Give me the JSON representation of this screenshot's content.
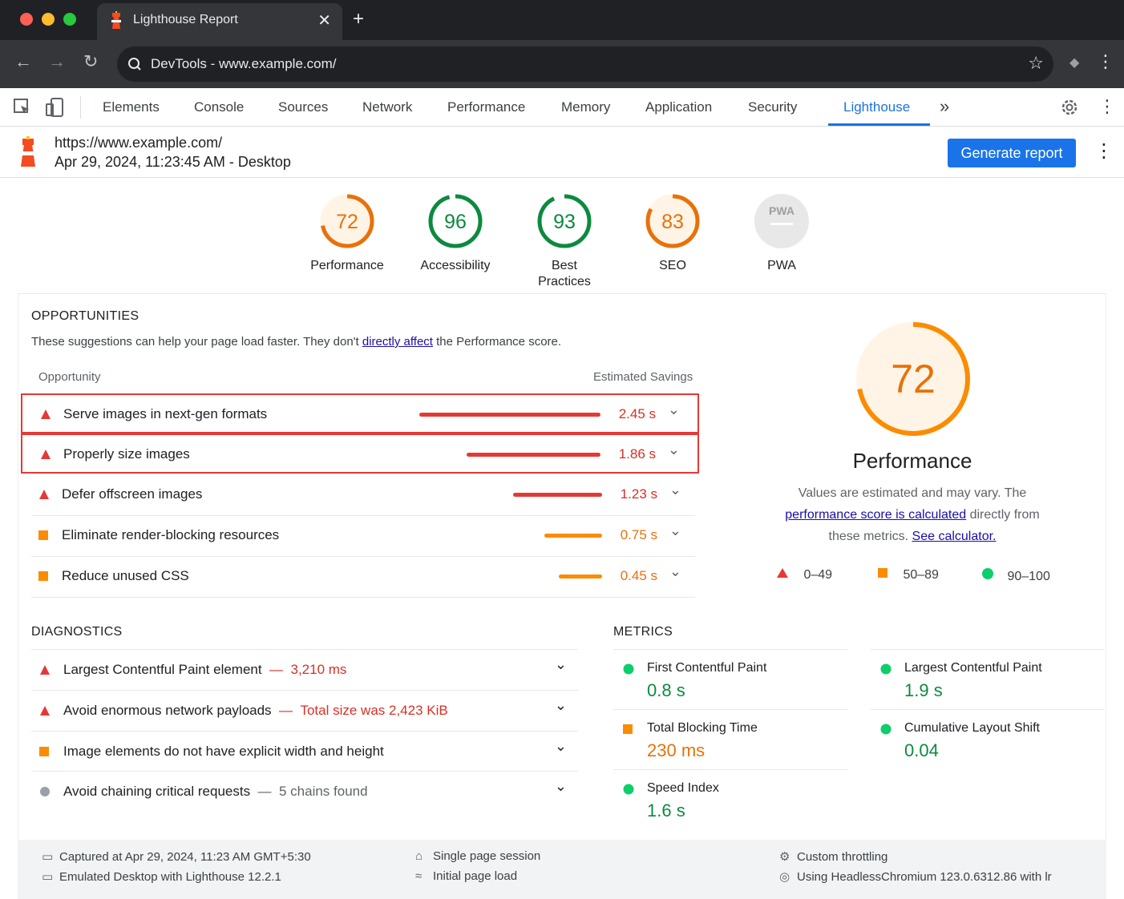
{
  "browser": {
    "tab_title": "Lighthouse Report",
    "tab_close": "✕",
    "new_tab": "+",
    "address": "DevTools - www.example.com/"
  },
  "devtools": {
    "tabs": [
      "Elements",
      "Console",
      "Sources",
      "Network",
      "Performance",
      "Memory",
      "Application",
      "Security",
      "Lighthouse"
    ],
    "more": "»"
  },
  "report": {
    "url": "https://www.example.com/",
    "date": "Apr 29, 2024, 11:23:45 AM - Desktop",
    "generate_label": "Generate report"
  },
  "gauges": [
    {
      "score": "72",
      "label": "Performance",
      "level": 0.72,
      "color": "#e8710a",
      "fill": "#fff4e5"
    },
    {
      "score": "96",
      "label": "Accessibility",
      "level": 0.96,
      "color": "#0c8a3e",
      "fill": "#ffffff"
    },
    {
      "score": "93",
      "label": "Best Practices",
      "level": 0.93,
      "color": "#0c8a3e",
      "fill": "#ffffff"
    },
    {
      "score": "83",
      "label": "SEO",
      "level": 0.83,
      "color": "#e8710a",
      "fill": "#fff4e5"
    },
    {
      "score": "PWA",
      "label": "PWA",
      "level": 0,
      "color": "#9aa0a6",
      "fill": "#e8e8e8"
    }
  ],
  "opportunities": {
    "title": "OPPORTUNITIES",
    "desc_before": "These suggestions can help your page load faster. They don't ",
    "desc_link": "directly affect",
    "desc_after": " the Performance score.",
    "col_opportunity": "Opportunity",
    "col_savings": "Estimated Savings",
    "items": [
      {
        "title": "Serve images in next-gen formats",
        "savings": "2.45 s",
        "severity": "fail",
        "fraction": 1.0
      },
      {
        "title": "Properly size images",
        "savings": "1.86 s",
        "severity": "fail",
        "fraction": 0.74
      },
      {
        "title": "Defer offscreen images",
        "savings": "1.23 s",
        "severity": "fail",
        "fraction": 0.49
      },
      {
        "title": "Eliminate render-blocking resources",
        "savings": "0.75 s",
        "severity": "average",
        "fraction": 0.32
      },
      {
        "title": "Reduce unused CSS",
        "savings": "0.45 s",
        "severity": "average",
        "fraction": 0.24
      }
    ]
  },
  "performance": {
    "score": "72",
    "level": 0.72,
    "title": "Performance",
    "desc_1": "Values are estimated and may vary. The",
    "desc_link": "performance score is calculated",
    "desc_2": " directly from",
    "desc_3": "these metrics. ",
    "desc_link2": "See calculator.",
    "legend": [
      "0–49",
      "50–89",
      "90–100"
    ]
  },
  "diagnostics": {
    "title": "DIAGNOSTICS",
    "items": [
      {
        "title": "Largest Contentful Paint element",
        "detail": " — 3,210 ms",
        "severity": "fail"
      },
      {
        "title": "Avoid enormous network payloads",
        "detail": " — Total size was 2,423 KiB",
        "severity": "fail"
      },
      {
        "title": "Image elements do not have explicit width and height",
        "detail": "",
        "severity": "average"
      },
      {
        "title": "Avoid chaining critical requests",
        "detail": " — 5 chains found",
        "severity": "info"
      }
    ]
  },
  "metrics": {
    "title": "METRICS",
    "items": [
      {
        "name": "First Contentful Paint",
        "value": "0.8 s",
        "severity": "pass"
      },
      {
        "name": "Largest Contentful Paint",
        "value": "1.9 s",
        "severity": "pass"
      },
      {
        "name": "Total Blocking Time",
        "value": "230 ms",
        "severity": "average"
      },
      {
        "name": "Cumulative Layout Shift",
        "value": "0.04",
        "severity": "pass"
      },
      {
        "name": "Speed Index",
        "value": "1.6 s",
        "severity": "pass"
      }
    ]
  },
  "footer": {
    "captured": "Captured at Apr 29, 2024, 11:23 AM GMT+5:30",
    "emulated": "Emulated Desktop with Lighthouse 12.2.1",
    "session": "Single page session",
    "load": "Initial page load",
    "throttling": "Custom throttling",
    "browser": "Using HeadlessChromium 123.0.6312.86 with lr"
  },
  "colors": {
    "fail": "#e53935",
    "average": "#fb8c00",
    "pass": "#0cce6b",
    "info": "#9aa0a6",
    "link": "#1a0dab",
    "accent": "#1a73e8"
  }
}
